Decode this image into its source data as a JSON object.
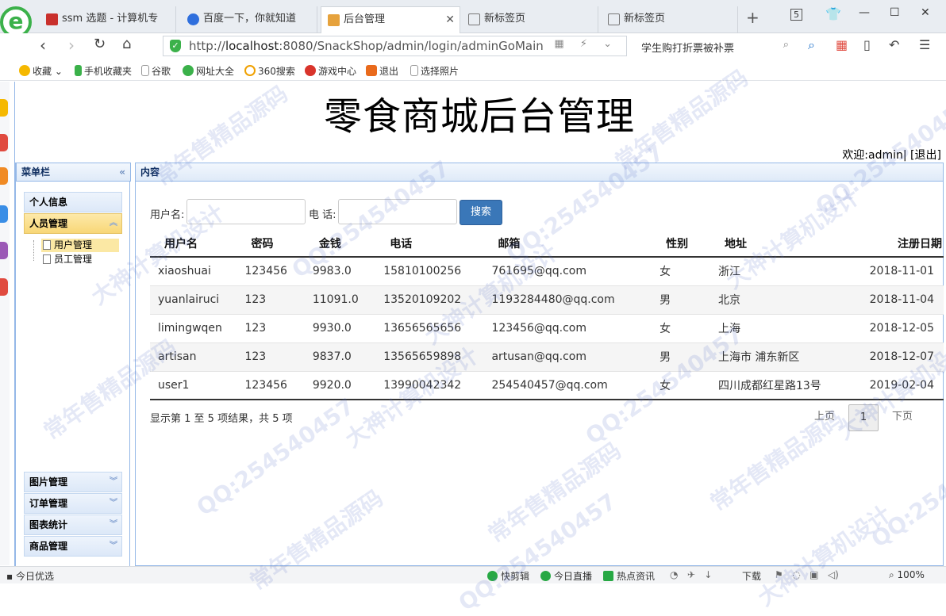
{
  "browser": {
    "tabs": [
      {
        "title": "ssm 选题 - 计算机专",
        "active": false,
        "color": "#c9302c"
      },
      {
        "title": "百度一下，你就知道",
        "active": false,
        "color": "#2f6fdd"
      },
      {
        "title": "后台管理",
        "active": true,
        "color": "#e6a23c"
      },
      {
        "title": "新标签页",
        "active": false,
        "color": "#888888"
      },
      {
        "title": "新标签页",
        "active": false,
        "color": "#888888"
      }
    ],
    "new_tab": "+",
    "tab_count": "5",
    "url_prefix": "http://",
    "url_host": "localhost",
    "url_rest": ":8080/SnackShop/admin/login/adminGoMain",
    "search_text": "学生购打折票被补票",
    "bookmarks": [
      "收藏",
      "手机收藏夹",
      "谷歌",
      "网址大全",
      "360搜索",
      "游戏中心",
      "退出",
      "选择照片"
    ]
  },
  "page": {
    "title": "零食商城后台管理",
    "welcome": "欢迎:admin| [退出]"
  },
  "menu": {
    "header": "菜单栏",
    "sections_top": [
      "个人信息",
      "人员管理"
    ],
    "tree_items": [
      "用户管理",
      "员工管理"
    ],
    "sections_bottom": [
      "图片管理",
      "订单管理",
      "图表统计",
      "商品管理"
    ]
  },
  "content": {
    "header": "内容",
    "filter": {
      "username_label": "用户名:",
      "phone_label": "电 话:",
      "search_button": "搜索"
    },
    "table": {
      "columns": [
        "用户名",
        "密码",
        "金钱",
        "电话",
        "邮箱",
        "性别",
        "地址",
        "注册日期"
      ],
      "rows": [
        [
          "xiaoshuai",
          "123456",
          "9983.0",
          "15810100256",
          "761695@qq.com",
          "女",
          "浙江",
          "2018-11-01"
        ],
        [
          "yuanlairuci",
          "123",
          "11091.0",
          "13520109202",
          "1193284480@qq.com",
          "男",
          "北京",
          "2018-11-04"
        ],
        [
          "limingwqen",
          "123",
          "9930.0",
          "13656565656",
          "123456@qq.com",
          "女",
          "上海",
          "2018-12-05"
        ],
        [
          "artisan",
          "123",
          "9837.0",
          "13565659898",
          "artusan@qq.com",
          "男",
          "上海市 浦东新区",
          "2018-12-07"
        ],
        [
          "user1",
          "123456",
          "9920.0",
          "13990042342",
          "254540457@qq.com",
          "女",
          "四川成都红星路13号",
          "2019-02-04"
        ]
      ]
    },
    "pager": {
      "info": "显示第 1 至 5 项结果，共 5 项",
      "prev": "上页",
      "current": "1",
      "next": "下页"
    }
  },
  "statusbar": {
    "left": "今日优选",
    "items": [
      "快剪辑",
      "今日直播",
      "热点资讯",
      "下载",
      "100%"
    ]
  },
  "watermark": {
    "lines": [
      "QQ:254540457",
      "常年售精品源码",
      "大神计算机设计"
    ]
  }
}
